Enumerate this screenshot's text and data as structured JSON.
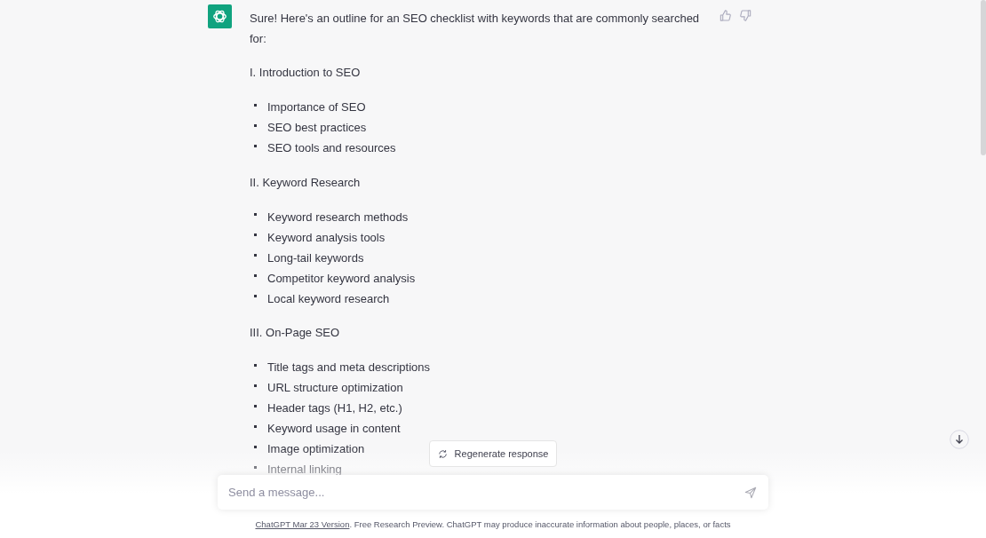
{
  "message": {
    "intro": "Sure! Here's an outline for an SEO checklist with keywords that are commonly searched for:",
    "sections": [
      {
        "heading": "I. Introduction to SEO",
        "items": [
          "Importance of SEO",
          "SEO best practices",
          "SEO tools and resources"
        ]
      },
      {
        "heading": "II. Keyword Research",
        "items": [
          "Keyword research methods",
          "Keyword analysis tools",
          "Long-tail keywords",
          "Competitor keyword analysis",
          "Local keyword research"
        ]
      },
      {
        "heading": "III. On-Page SEO",
        "items": [
          "Title tags and meta descriptions",
          "URL structure optimization",
          "Header tags (H1, H2, etc.)",
          "Keyword usage in content",
          "Image optimization",
          "Internal linking"
        ]
      }
    ]
  },
  "regenerate_button": "Regenerate response",
  "composer": {
    "placeholder": "Send a message..."
  },
  "footer": {
    "link": "ChatGPT Mar 23 Version",
    "text": ". Free Research Preview. ChatGPT may produce inaccurate information about people, places, or facts"
  }
}
